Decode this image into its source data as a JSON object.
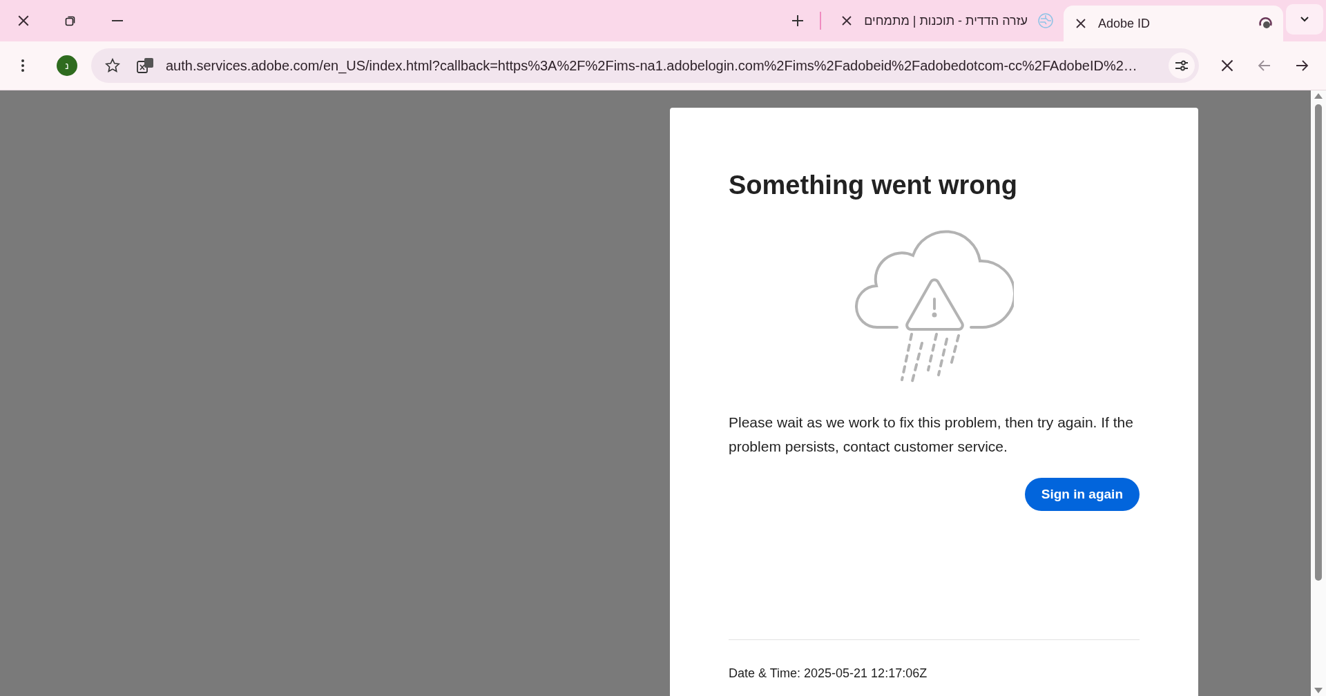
{
  "tabs": [
    {
      "title": "עזרה הדדית - תוכנות | מתמחים",
      "selected": false
    },
    {
      "title": "Adobe ID",
      "selected": true
    }
  ],
  "toolbar": {
    "avatar": "נ",
    "url": "auth.services.adobe.com/en_US/index.html?callback=https%3A%2F%2Fims-na1.adobelogin.com%2Fims%2Fadobeid%2Fadobedotcom-cc%2FAdobeID%2…",
    "nav": [
      {
        "kind": "stop",
        "disabled": false
      },
      {
        "kind": "back",
        "disabled": true
      },
      {
        "kind": "forward",
        "disabled": false
      }
    ]
  },
  "card": {
    "title": "Something went wrong",
    "message": "Please wait as we work to fix this problem, then try again. If the problem persists, contact customer service.",
    "button": "Sign in again",
    "datetime": "Date & Time: 2025-05-21 12:17:06Z"
  }
}
